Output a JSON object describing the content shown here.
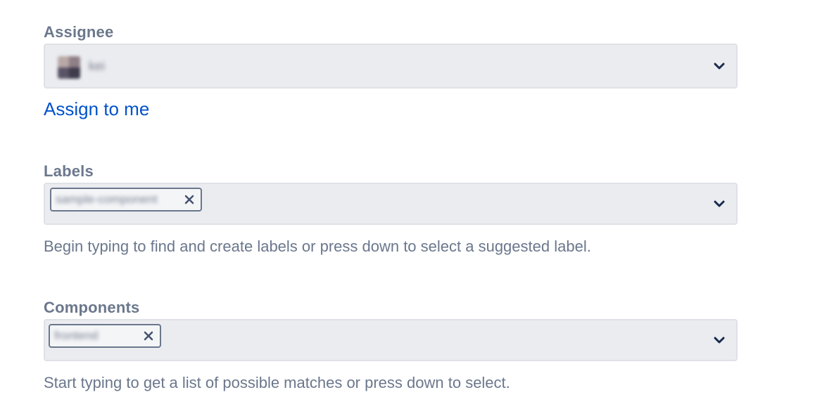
{
  "assignee": {
    "label": "Assignee",
    "selected_name": "kei",
    "assign_to_me": "Assign to me",
    "dropdown_icon": "chevron-down-icon"
  },
  "labels": {
    "label": "Labels",
    "tag_text": "sample-component",
    "help_text": "Begin typing to find and create labels or press down to select a suggested label.",
    "remove_icon": "close-icon",
    "dropdown_icon": "chevron-down-icon"
  },
  "components": {
    "label": "Components",
    "tag_text": "frontend",
    "help_text": "Start typing to get a list of possible matches or press down to select.",
    "remove_icon": "close-icon",
    "dropdown_icon": "chevron-down-icon"
  },
  "colors": {
    "label": "#6b778c",
    "link": "#0052cc",
    "field_bg": "#ebecf0",
    "field_border": "#dfe1e6",
    "tag_border": "#6b778c"
  }
}
